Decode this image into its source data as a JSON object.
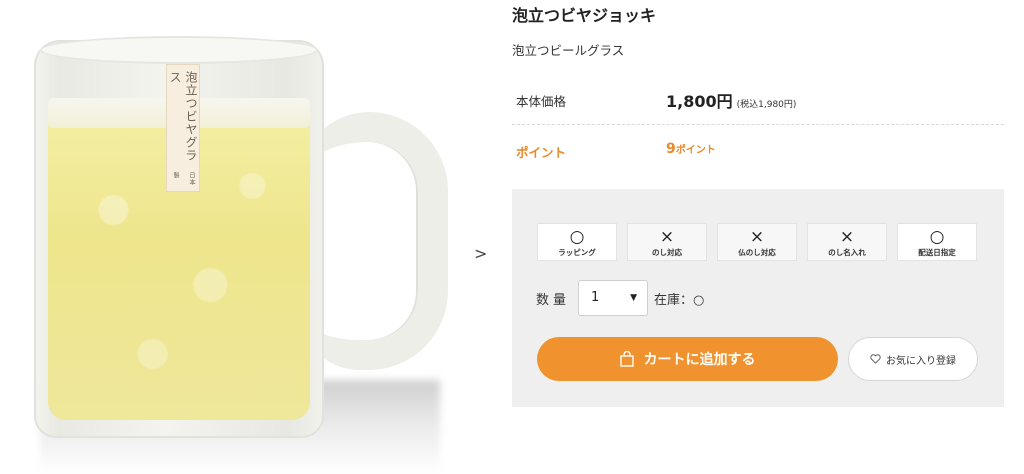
{
  "product": {
    "title": "泡立つビヤジョッキ",
    "subtitle": "泡立つビールグラス",
    "image_label": {
      "main": "泡立つビヤグラス",
      "small": "日本製"
    }
  },
  "gallery": {
    "next_icon": "chevron-right-icon",
    "next_label": ">"
  },
  "price": {
    "label": "本体価格",
    "value": "1,800円",
    "tax_included": "(税込1,980円)"
  },
  "points": {
    "label": "ポイント",
    "value": "9",
    "unit": "ポイント"
  },
  "features": [
    {
      "mark": "○",
      "label": "ラッピング"
    },
    {
      "mark": "×",
      "label": "のし対応"
    },
    {
      "mark": "×",
      "label": "仏のし対応"
    },
    {
      "mark": "×",
      "label": "のし名入れ"
    },
    {
      "mark": "○",
      "label": "配送日指定"
    }
  ],
  "quantity": {
    "label": "数量",
    "selected": "1",
    "caret": "▼"
  },
  "stock": {
    "text": "在庫：○"
  },
  "buttons": {
    "cart": "カートに追加する",
    "cart_icon": "shopping-bag-icon",
    "favorite": "お気に入り登録",
    "favorite_icon": "heart-icon"
  },
  "colors": {
    "accent": "#f0922e",
    "point_text": "#e8892a",
    "panel_bg": "#efefef"
  }
}
